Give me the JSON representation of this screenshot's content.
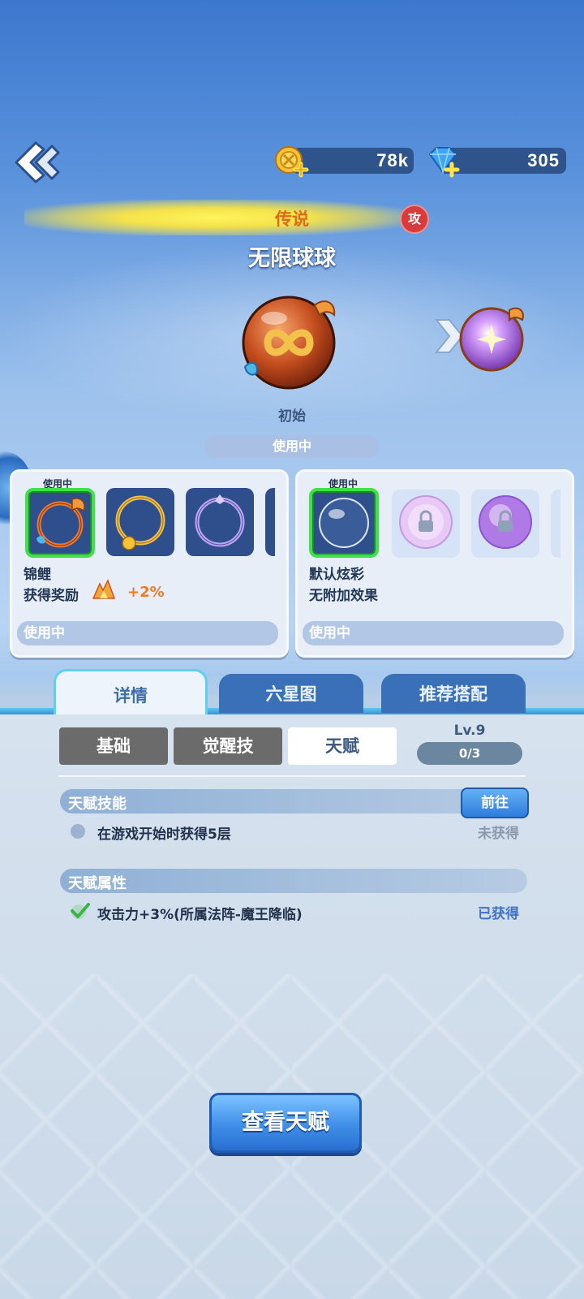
{
  "resources": {
    "coins": "78k",
    "gems": "305"
  },
  "ball": {
    "rarity": "传说",
    "type_badge": "攻",
    "name": "无限球球",
    "stage": "初始",
    "status": "使用中"
  },
  "left_card": {
    "tag": "使用中",
    "item_name": "锦鲤",
    "reward_label": "获得奖励",
    "reward_value": "+2%",
    "status": "使用中"
  },
  "right_card": {
    "tag": "使用中",
    "item_name": "默认炫彩",
    "effect": "无附加效果",
    "status": "使用中"
  },
  "tabs": [
    {
      "label": "详情",
      "active": true
    },
    {
      "label": "六星图",
      "active": false
    },
    {
      "label": "推荐搭配",
      "active": false
    }
  ],
  "subtabs": [
    {
      "label": "基础",
      "active": false
    },
    {
      "label": "觉醒技",
      "active": false
    },
    {
      "label": "天赋",
      "active": true
    }
  ],
  "level": {
    "label": "Lv.9",
    "progress": "0/3"
  },
  "talent_skill": {
    "title": "天赋技能",
    "goto_label": "前往",
    "row_text": "在游戏开始时获得5层",
    "row_status": "未获得"
  },
  "talent_attr": {
    "title": "天赋属性",
    "row_text": "攻击力+3%(所属法阵-魔王降临)",
    "row_status": "已获得"
  },
  "view_button": "查看天赋",
  "colors": {
    "accent_green": "#3fe04a",
    "tab_active": "#eef4fb",
    "tab_inactive": "#3a70b8",
    "button_blue": "#3f8ee8"
  }
}
